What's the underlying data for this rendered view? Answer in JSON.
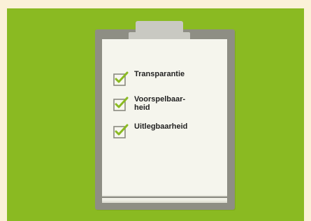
{
  "checklist": {
    "items": [
      {
        "label": "Transparantie"
      },
      {
        "label": "Voorspelbaar-\nheid"
      },
      {
        "label": "Uitlegbaarheid"
      }
    ]
  },
  "colors": {
    "border": "#fbf1d8",
    "panel": "#8aba22",
    "clipboard": "#8e8e84",
    "paper": "#f5f5ed",
    "check": "#8aba22",
    "text": "#222222"
  },
  "icons": {
    "check": "checkbox-check-icon"
  }
}
